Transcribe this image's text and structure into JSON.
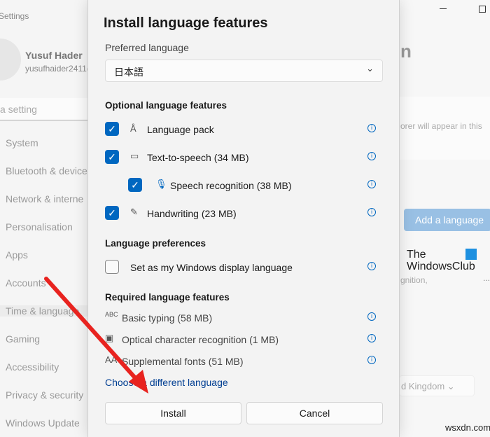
{
  "window": {
    "app_title": "Settings"
  },
  "profile": {
    "name": "Yusuf Hader",
    "email": "yusufhaider2411("
  },
  "search": {
    "placeholder": "a setting"
  },
  "sidebar": {
    "items": [
      {
        "label": "System"
      },
      {
        "label": "Bluetooth & device"
      },
      {
        "label": "Network & interne"
      },
      {
        "label": "Personalisation"
      },
      {
        "label": "Apps"
      },
      {
        "label": "Accounts"
      },
      {
        "label": "Time & language"
      },
      {
        "label": "Gaming"
      },
      {
        "label": "Accessibility"
      },
      {
        "label": "Privacy & security"
      },
      {
        "label": "Windows Update"
      }
    ]
  },
  "background": {
    "heading_fragment": "n",
    "desc_fragment": "orer will appear in this",
    "add_language": "Add a language",
    "features_fragment": "gnition,",
    "more": "...",
    "region_fragment": "d Kingdom",
    "logo_line1": "The",
    "logo_line2": "WindowsClub",
    "watermark": "wsxdn.com"
  },
  "dialog": {
    "title": "Install language features",
    "preferred_label": "Preferred language",
    "preferred_value": "日本語",
    "optional_header": "Optional language features",
    "optional": [
      {
        "label": "Language pack",
        "checked": true,
        "icon": "language-pack-icon"
      },
      {
        "label": "Text-to-speech (34 MB)",
        "checked": true,
        "icon": "speech-icon"
      },
      {
        "label": "Speech recognition (38 MB)",
        "checked": true,
        "icon": "microphone-icon"
      },
      {
        "label": "Handwriting (23 MB)",
        "checked": true,
        "icon": "handwriting-icon"
      }
    ],
    "prefs_header": "Language preferences",
    "display_lang_label": "Set as my Windows display language",
    "display_lang_checked": false,
    "required_header": "Required language features",
    "required": [
      {
        "label": "Basic typing (58 MB)",
        "icon": "abc-check-icon"
      },
      {
        "label": "Optical character recognition (1 MB)",
        "icon": "ocr-icon"
      },
      {
        "label": "Supplemental fonts (51 MB)",
        "icon": "fonts-icon"
      }
    ],
    "choose_link": "Choose a different language",
    "install": "Install",
    "cancel": "Cancel"
  },
  "colors": {
    "accent": "#0067c0",
    "arrow": "#e8231f"
  }
}
